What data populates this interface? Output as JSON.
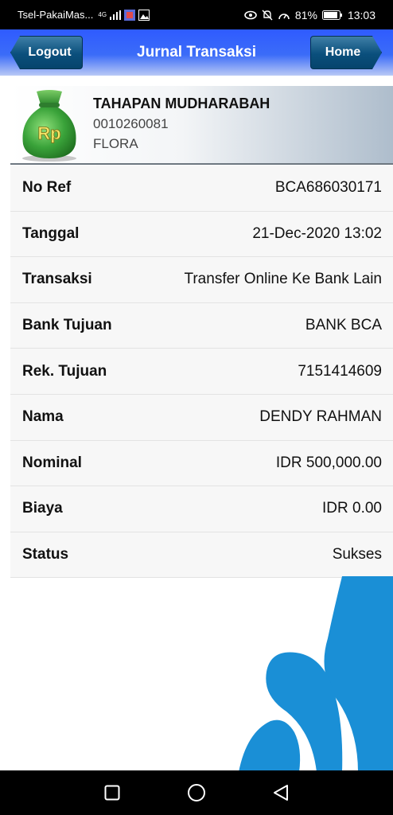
{
  "status_bar": {
    "carrier": "Tsel-PakaiMas...",
    "network": "4G",
    "battery": "81%",
    "time": "13:03"
  },
  "header": {
    "logout_label": "Logout",
    "title": "Jurnal Transaksi",
    "home_label": "Home"
  },
  "account": {
    "type": "TAHAPAN MUDHARABAH",
    "number": "0010260081",
    "name": "FLORA",
    "icon_text": "Rp"
  },
  "details": [
    {
      "label": "No Ref",
      "value": "BCA686030171"
    },
    {
      "label": "Tanggal",
      "value": "21-Dec-2020 13:02"
    },
    {
      "label": "Transaksi",
      "value": "Transfer Online Ke Bank Lain"
    },
    {
      "label": "Bank Tujuan",
      "value": "BANK BCA"
    },
    {
      "label": "Rek. Tujuan",
      "value": "7151414609"
    },
    {
      "label": "Nama",
      "value": "DENDY RAHMAN"
    },
    {
      "label": "Nominal",
      "value": "IDR 500,000.00"
    },
    {
      "label": "Biaya",
      "value": "IDR 0.00"
    },
    {
      "label": "Status",
      "value": "Sukses"
    }
  ],
  "colors": {
    "header_blue": "#2f5bff",
    "button_navy": "#0a4f7c",
    "deco_blue": "#1a8fd6",
    "bag_green": "#3aa33a"
  },
  "icons": {
    "bag": "money-bag-icon",
    "nav_recent": "square-icon",
    "nav_home": "circle-icon",
    "nav_back": "triangle-back-icon"
  }
}
